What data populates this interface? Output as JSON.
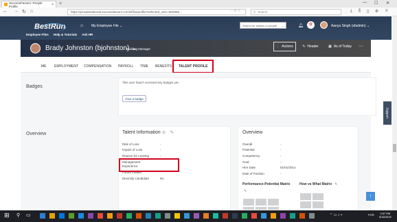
{
  "browser": {
    "tab_title": "SuccessFactors: People Profile",
    "tab_close": "×",
    "new_tab": "+",
    "url": "https://pmsalesdemo8.successfactors.com/sf/liveprofile?selected_user=802966...",
    "url_more": "··· ✩ ☆",
    "search_placeholder": "Search",
    "window_controls": [
      "—",
      "☐",
      "✕"
    ]
  },
  "sf_header": {
    "logo_text": "BestRun",
    "module_menu": "My Employee File ⌄",
    "links": [
      "Employee Files",
      "Help & Tutorials",
      "Ask HR"
    ],
    "people_search_placeholder": "Search for actions or people",
    "user_name": "Aanya Singh (sfadmin) ⌄"
  },
  "profile": {
    "name": "Brady Johnston (bjohnston) ⌄",
    "title": "Building Manager",
    "actions_label": "Actions",
    "header_label": "Header",
    "as_of_label": "As of Today"
  },
  "tabs": [
    "ME",
    "EMPLOYMENT",
    "COMPENSATION",
    "PAYROLL",
    "TIME",
    "BENEFITS",
    "TALENT PROFILE"
  ],
  "badges": {
    "section_title": "Badges",
    "empty_text": "This user hasn't received any badges yet.",
    "give_button": "Give a badge"
  },
  "overview_section_title": "Overview",
  "talent_information": {
    "title": "Talent Information",
    "fields": [
      {
        "label": "Risk of Loss",
        "value": "-"
      },
      {
        "label": "Impact of Loss",
        "value": "-"
      },
      {
        "label": "Reason for Leaving",
        "value": "-"
      },
      {
        "label": "Management",
        "value": ""
      },
      {
        "label": "Experience",
        "value": ""
      },
      {
        "label": "Future Leader",
        "value": ""
      },
      {
        "label": "Diversity Candidate",
        "value": "No"
      }
    ]
  },
  "overview_card": {
    "title": "Overview",
    "fields": [
      {
        "label": "Overall",
        "value": "-"
      },
      {
        "label": "Potential",
        "value": "-"
      },
      {
        "label": "Competency",
        "value": "-"
      },
      {
        "label": "Goal",
        "value": "-"
      },
      {
        "label": "Hire Date",
        "value": "01/01/2014"
      },
      {
        "label": "Date of Position",
        "value": "-"
      }
    ],
    "ppm_title": "Performance-Potential Matrix",
    "vhw_title": "How vs What Matrix"
  },
  "support_label": "Support",
  "taskbar": {
    "language": "POR",
    "time": "2:57 PM",
    "date": "6/18/2020"
  },
  "colors": {
    "header_bg": "#2b3d56",
    "highlight_red": "#d0021b",
    "support_bg": "#3d4e63"
  }
}
